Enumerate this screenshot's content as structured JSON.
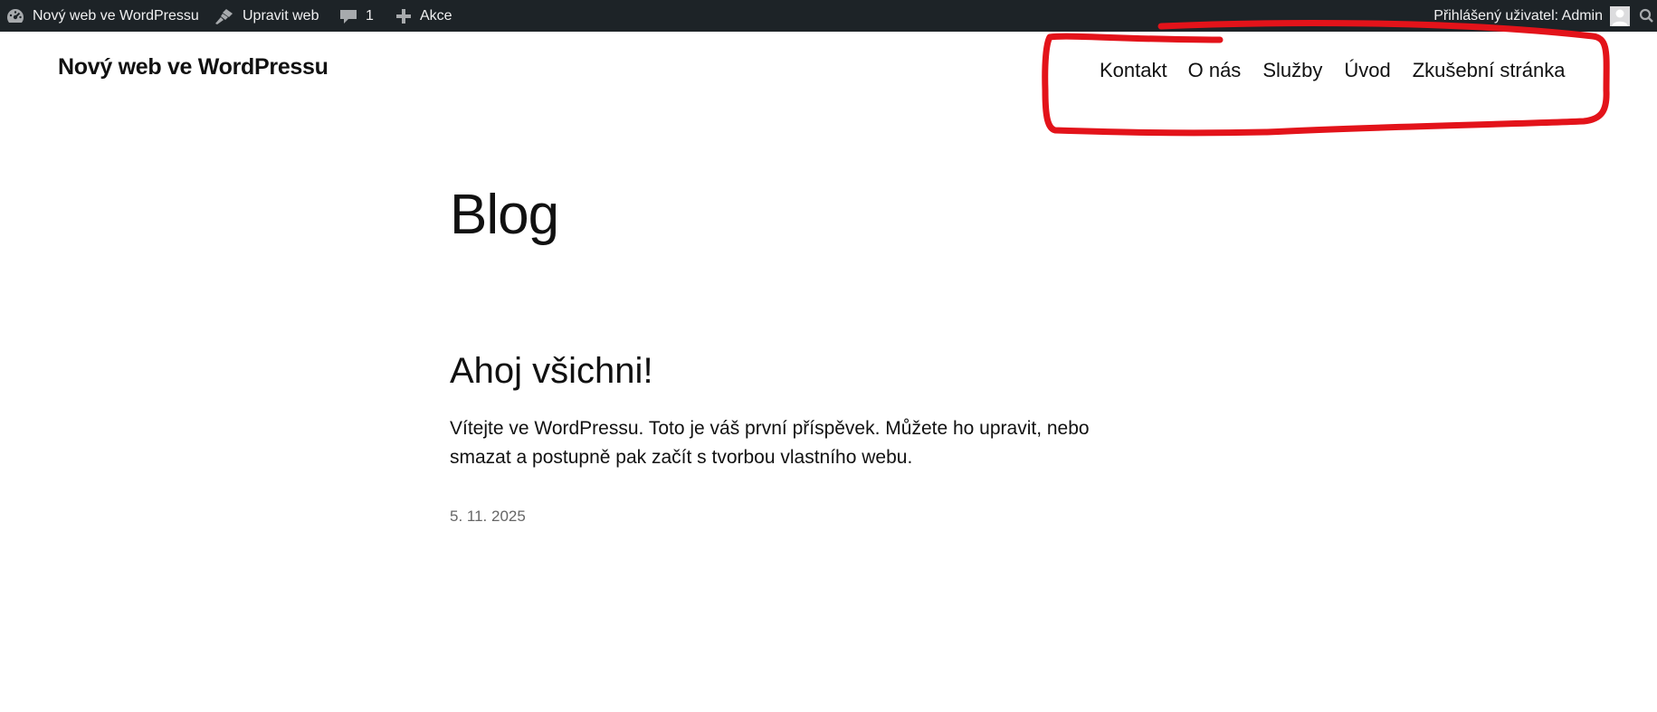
{
  "admin_bar": {
    "site_name": "Nový web ve WordPressu",
    "edit_site": "Upravit web",
    "comments_count": "1",
    "new_label": "Akce",
    "user_greeting": "Přihlášený uživatel: Admin",
    "icons": {
      "site": "wordpress-dashboard-icon",
      "edit": "paintbrush-icon",
      "comments": "comment-bubble-icon",
      "new": "plus-icon",
      "search": "search-icon"
    },
    "background_color": "#1d2327",
    "text_color": "#f0f0f1"
  },
  "header": {
    "site_title": "Nový web ve WordPressu",
    "nav_items": [
      {
        "label": "Kontakt"
      },
      {
        "label": "O nás"
      },
      {
        "label": "Služby"
      },
      {
        "label": "Úvod"
      },
      {
        "label": "Zkušební stránka"
      }
    ]
  },
  "annotation": {
    "color": "#e3131a",
    "description_shape": "hand-drawn rectangle around navigation"
  },
  "main": {
    "page_title": "Blog",
    "posts": [
      {
        "title": "Ahoj všichni!",
        "excerpt": "Vítejte ve WordPressu. Toto je váš první příspěvek. Můžete ho upravit, nebo smazat a postupně pak začít s tvorbou vlastního webu.",
        "date": "5. 11. 2025"
      }
    ]
  }
}
